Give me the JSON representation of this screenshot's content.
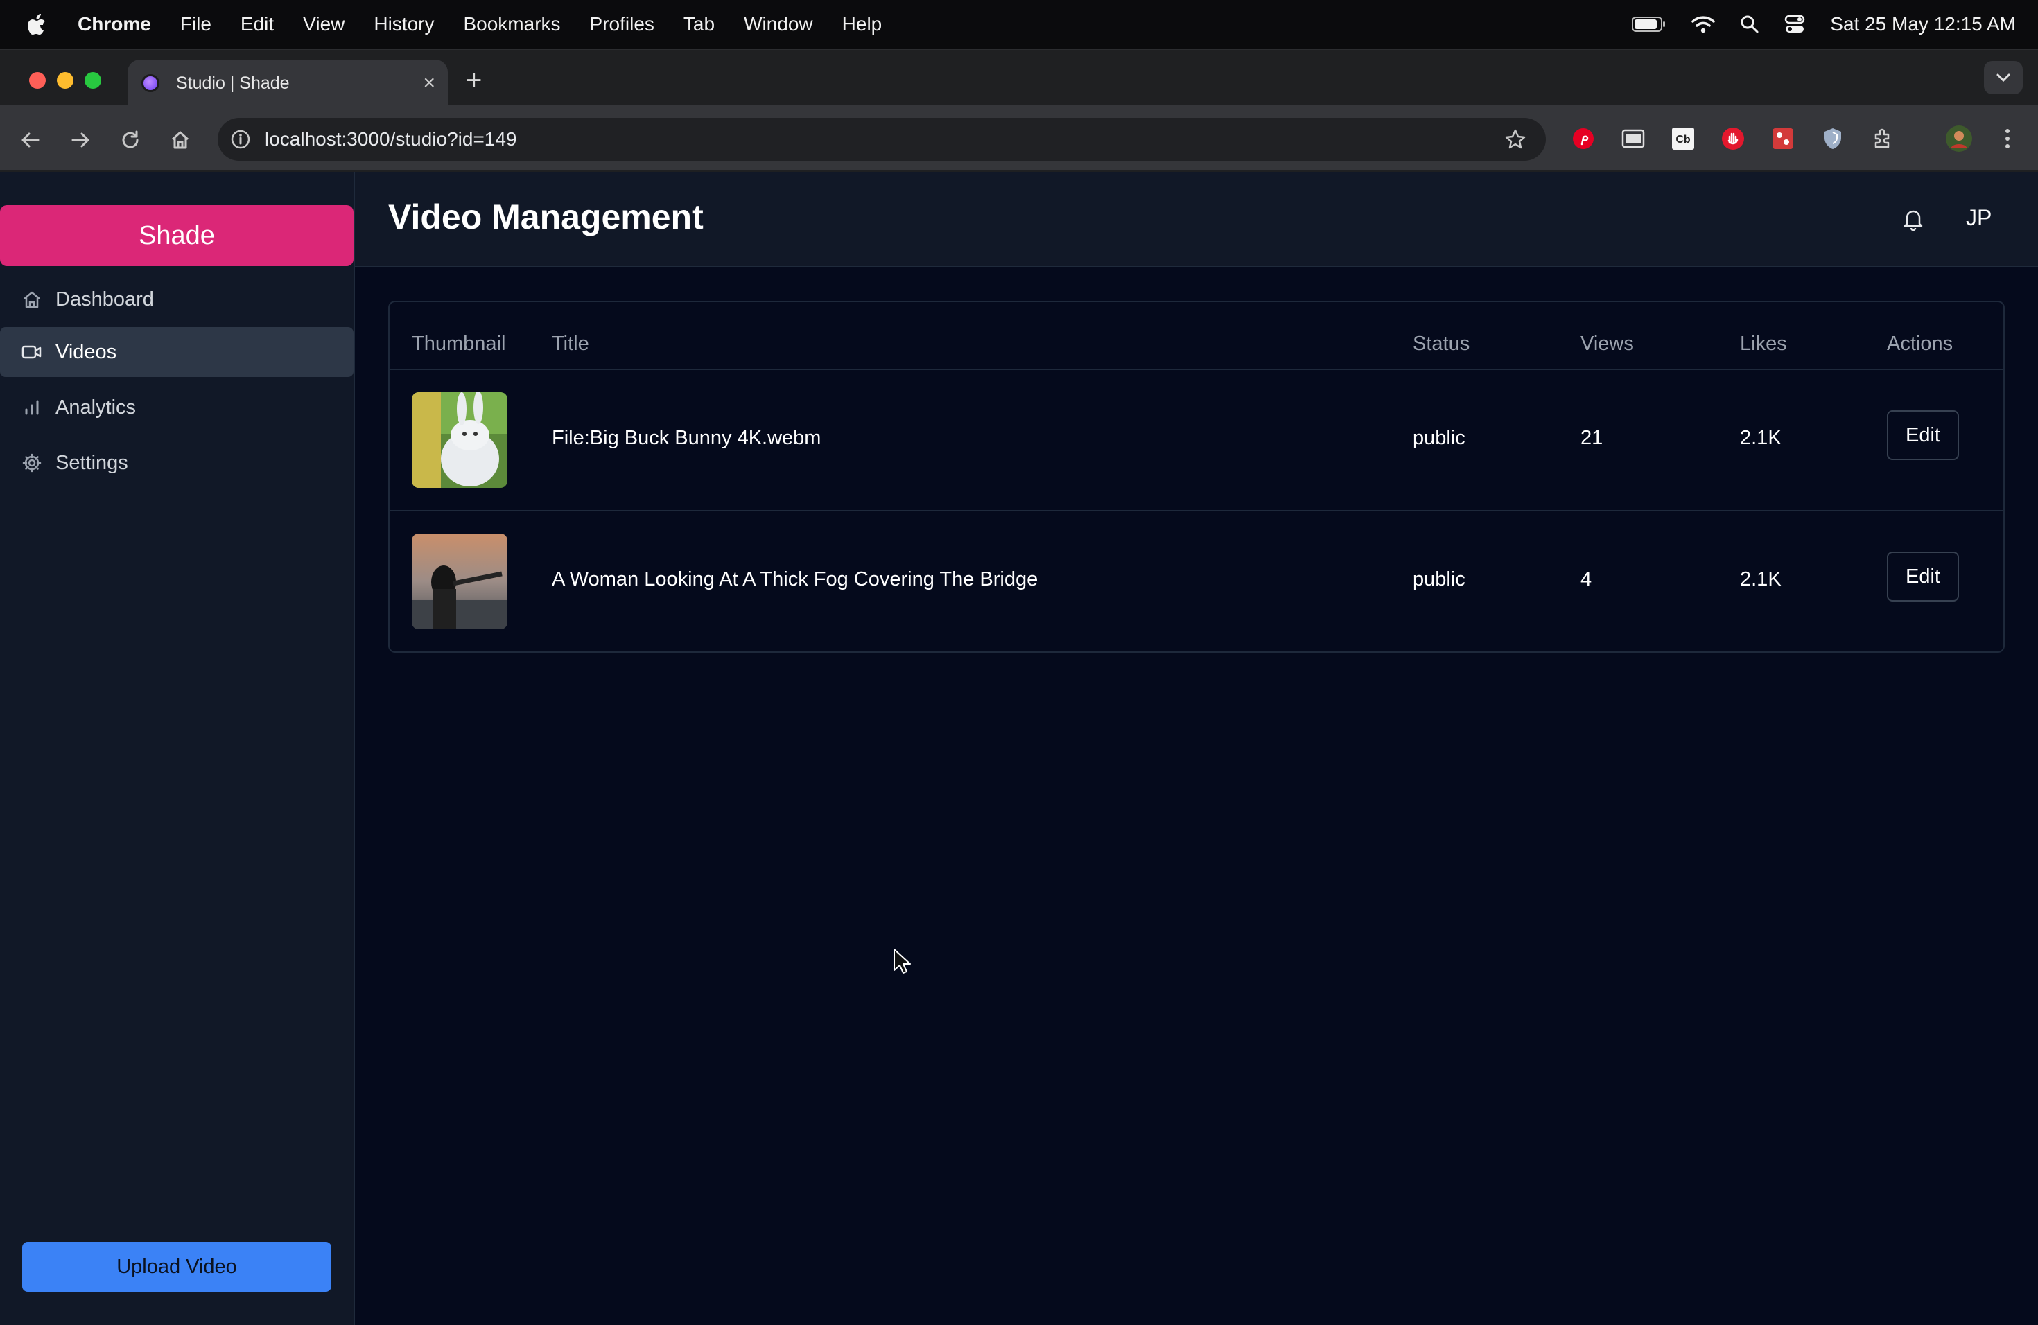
{
  "macos": {
    "menus": [
      "Chrome",
      "File",
      "Edit",
      "View",
      "History",
      "Bookmarks",
      "Profiles",
      "Tab",
      "Window",
      "Help"
    ],
    "clock": "Sat 25 May  12:15 AM"
  },
  "browser": {
    "tab_title": "Studio | Shade",
    "tab_close": "×",
    "new_tab": "+",
    "url": "localhost:3000/studio?id=149"
  },
  "sidebar": {
    "brand": "Shade",
    "items": [
      {
        "label": "Dashboard",
        "icon": "home-icon",
        "active": false
      },
      {
        "label": "Videos",
        "icon": "video-icon",
        "active": true
      },
      {
        "label": "Analytics",
        "icon": "bar-chart-icon",
        "active": false
      },
      {
        "label": "Settings",
        "icon": "gear-icon",
        "active": false
      }
    ],
    "upload_label": "Upload Video"
  },
  "header": {
    "title": "Video Management",
    "user_initials": "JP"
  },
  "table": {
    "columns": [
      "Thumbnail",
      "Title",
      "Status",
      "Views",
      "Likes",
      "Actions"
    ],
    "rows": [
      {
        "title": "File:Big Buck Bunny 4K.webm",
        "status": "public",
        "views": "21",
        "likes": "2.1K",
        "action": "Edit"
      },
      {
        "title": "A Woman Looking At A Thick Fog Covering The Bridge",
        "status": "public",
        "views": "4",
        "likes": "2.1K",
        "action": "Edit"
      }
    ]
  },
  "colors": {
    "brand": "#db2777",
    "upload": "#3b82f6",
    "background": "#050a1c",
    "panel": "#111827"
  }
}
